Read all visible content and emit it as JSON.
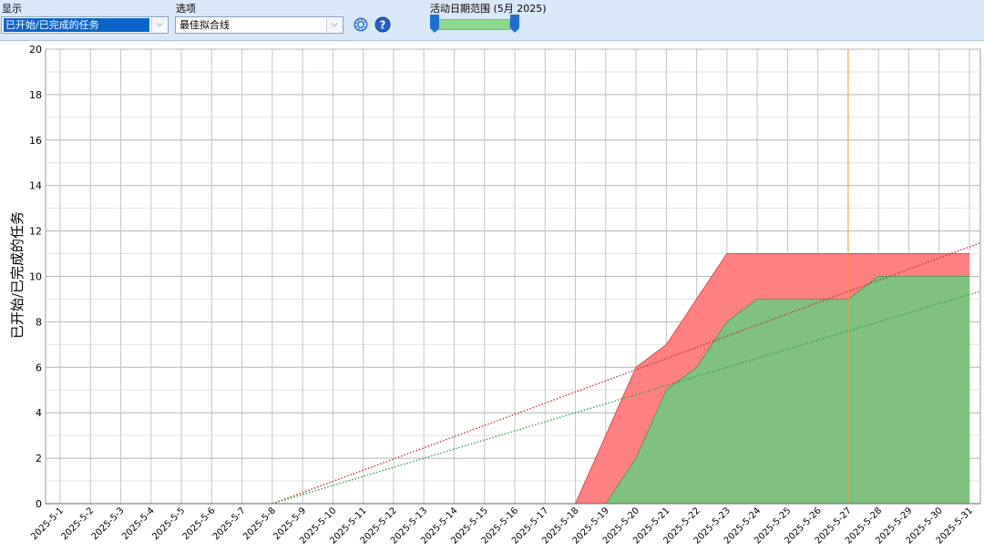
{
  "toolbar": {
    "display_label": "显示",
    "display_value": "已开始/已完成的任务",
    "options_label": "选项",
    "options_value": "最佳拟合线",
    "range_label": "活动日期范围 (5月 2025)",
    "colors": {
      "background": "#dbe8fa",
      "selected": "#0a64c8",
      "range": "#8cd88c",
      "handle": "#1f6fd0"
    },
    "icons": {
      "settings": "gear-icon",
      "help": "help-icon",
      "dropdown": "chevron-down-icon"
    }
  },
  "chart_data": {
    "type": "area",
    "ylabel": "已开始/已完成的任务",
    "xlabel": "",
    "ylim": [
      0,
      20
    ],
    "yticks": [
      0,
      2,
      4,
      6,
      8,
      10,
      12,
      14,
      16,
      18,
      20
    ],
    "grid": true,
    "categories": [
      "2025-5-1",
      "2025-5-2",
      "2025-5-3",
      "2025-5-4",
      "2025-5-5",
      "2025-5-6",
      "2025-5-7",
      "2025-5-8",
      "2025-5-9",
      "2025-5-10",
      "2025-5-11",
      "2025-5-12",
      "2025-5-13",
      "2025-5-14",
      "2025-5-15",
      "2025-5-16",
      "2025-5-17",
      "2025-5-18",
      "2025-5-19",
      "2025-5-20",
      "2025-5-21",
      "2025-5-22",
      "2025-5-23",
      "2025-5-24",
      "2025-5-25",
      "2025-5-26",
      "2025-5-27",
      "2025-5-28",
      "2025-5-29",
      "2025-5-30",
      "2025-5-31"
    ],
    "series": [
      {
        "color": "#ff8080",
        "values": [
          0,
          0,
          0,
          0,
          0,
          0,
          0,
          0,
          0,
          0,
          0,
          0,
          0,
          0,
          0,
          0,
          0,
          0,
          3,
          6,
          7,
          9,
          11,
          11,
          11,
          11,
          11,
          11,
          11,
          11,
          11
        ]
      },
      {
        "color": "#80c080",
        "values": [
          0,
          0,
          0,
          0,
          0,
          0,
          0,
          0,
          0,
          0,
          0,
          0,
          0,
          0,
          0,
          0,
          0,
          0,
          0,
          2,
          5,
          6,
          8,
          9,
          9,
          9,
          9,
          10,
          10,
          10,
          10
        ]
      }
    ],
    "trendlines": [
      {
        "color": "#c03030",
        "x": [
          "2025-5-8",
          "2025-5-31"
        ],
        "y": [
          0,
          11.3
        ]
      },
      {
        "color": "#30a050",
        "x": [
          "2025-5-8",
          "2025-5-31"
        ],
        "y": [
          0,
          9.2
        ]
      }
    ],
    "marker_date": "2025-5-27",
    "marker_color": "#f0a030"
  }
}
